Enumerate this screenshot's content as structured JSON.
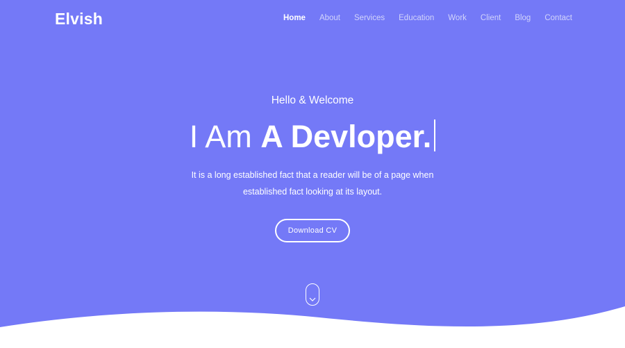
{
  "brand": {
    "name": "Elvish"
  },
  "nav": {
    "items": [
      {
        "label": "Home",
        "active": true
      },
      {
        "label": "About"
      },
      {
        "label": "Services"
      },
      {
        "label": "Education"
      },
      {
        "label": "Work"
      },
      {
        "label": "Client"
      },
      {
        "label": "Blog"
      },
      {
        "label": "Contact"
      }
    ]
  },
  "hero": {
    "greeting": "Hello & Welcome",
    "headline_light": "I Am ",
    "headline_bold": "A Devloper.",
    "description_line1": "It is a long established fact that a reader will be of a page when",
    "description_line2": "established fact looking at its layout.",
    "cta_label": "Download CV",
    "scroll_icon": "chevron-down-icon"
  },
  "colors": {
    "background": "#7479f7",
    "text": "#ffffff",
    "nav_inactive": "#d3d5fb"
  }
}
